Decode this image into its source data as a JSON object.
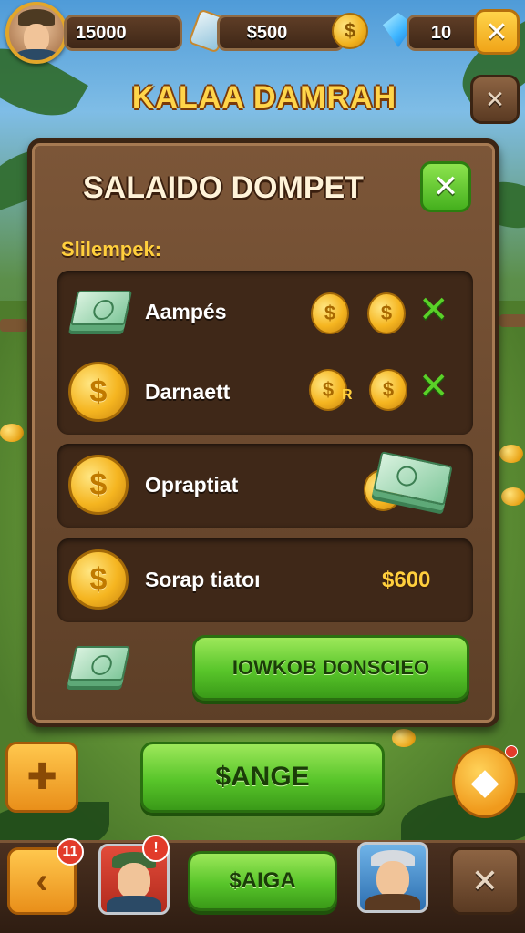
{
  "topbar": {
    "coins_value": "15000",
    "cash_value": "$500",
    "gold_symbol": "$",
    "gems_value": "10",
    "close_symbol": "✕"
  },
  "screen_title": "KALAA DAMRAH",
  "panel": {
    "title": "SALAIDO DOMPET",
    "close_symbol": "✕",
    "subtitle": "Slilempek:",
    "rows": [
      {
        "label": "Aampés",
        "mark": "✕"
      },
      {
        "label": "Darnaett",
        "mark": "✕",
        "coin_suffix": "R"
      },
      {
        "label": "Opraptiat"
      },
      {
        "label": "Sorap tiatoı",
        "value": "$600"
      }
    ],
    "action_button": "IOWKOB DONSCIEO",
    "coin_symbol": "$"
  },
  "main_button": "$ANGE",
  "side_left_symbol": "✚",
  "side_right_symbol": "◆",
  "secondary_close_symbol": "✕",
  "dock": {
    "back_badge": "11",
    "portrait_badge": "!",
    "center_button": "$AIGA",
    "back_symbol": "‹",
    "close_symbol": "✕"
  },
  "colors": {
    "accent_gold": "#ffcf3d",
    "panel_brown": "#5d3f27",
    "button_green": "#58c52a",
    "badge_red": "#e23b2a"
  }
}
